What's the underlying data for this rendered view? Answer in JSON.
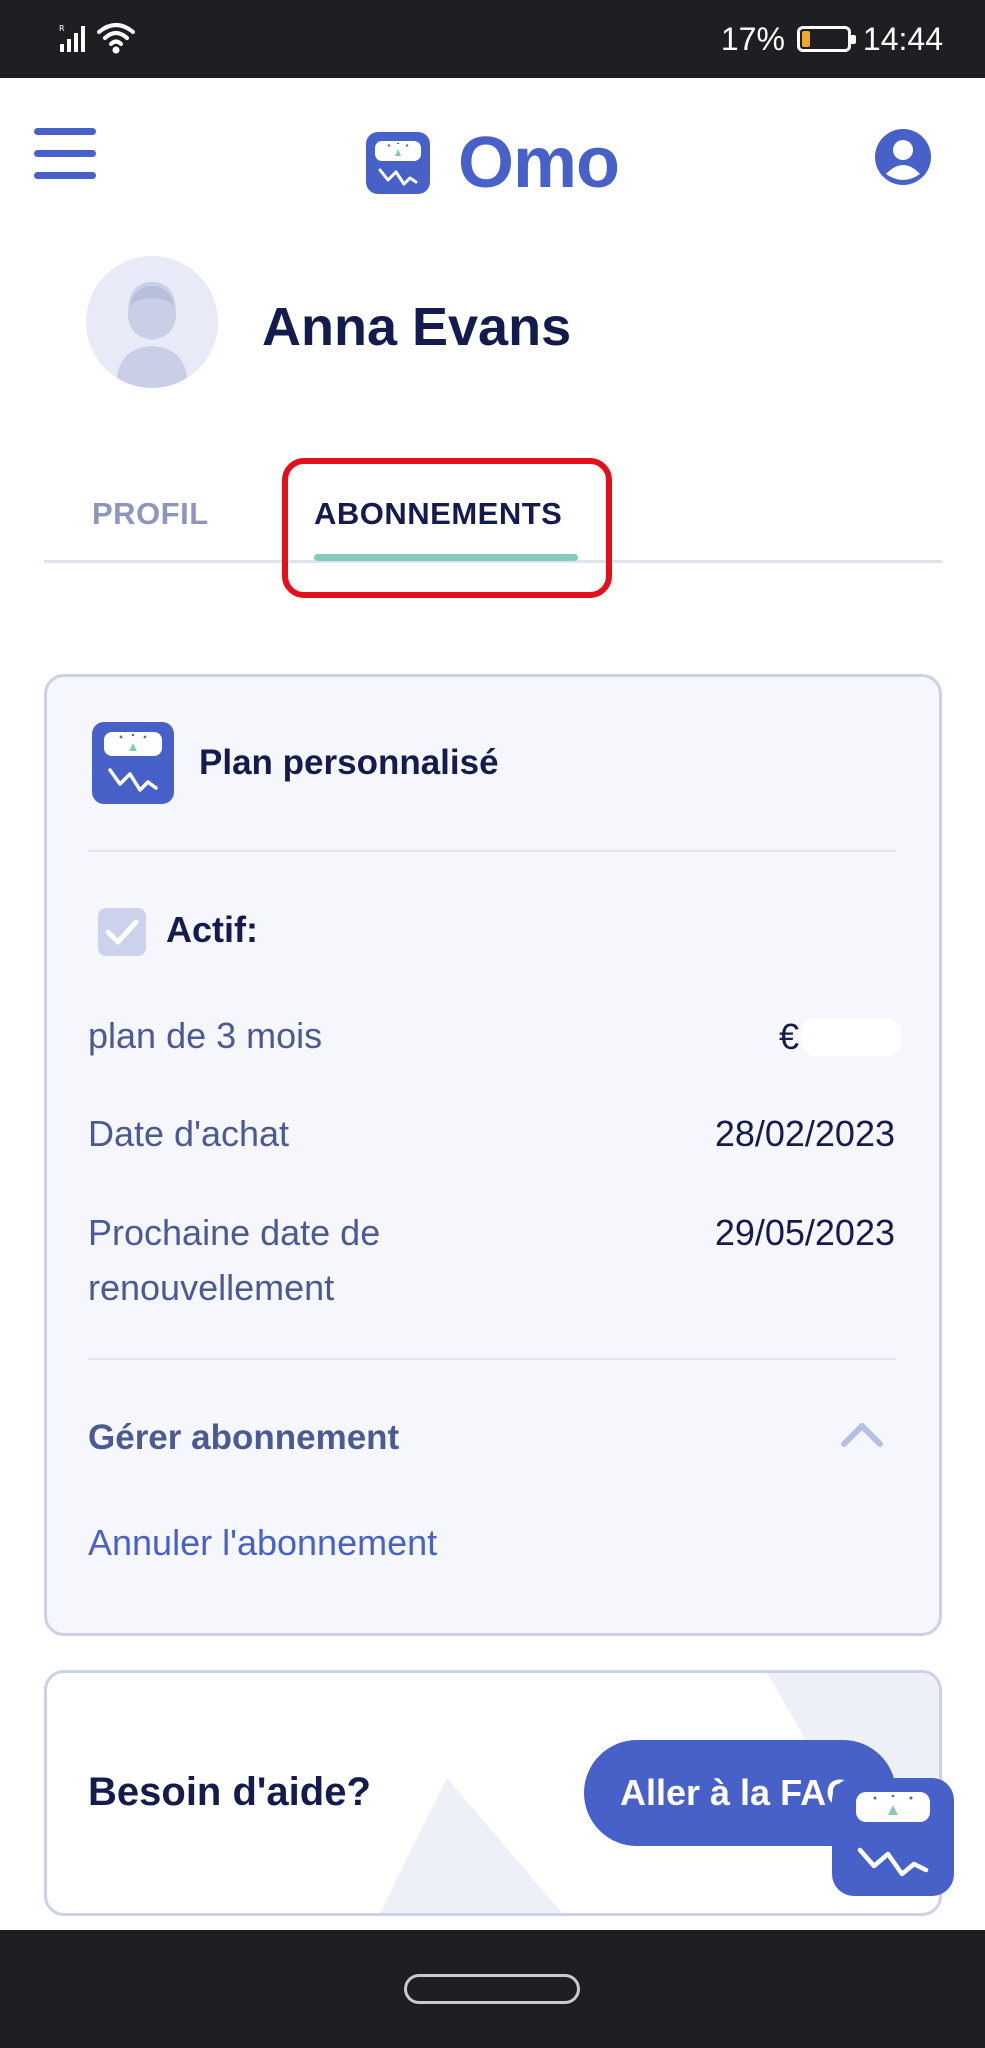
{
  "status_bar": {
    "battery": "17%",
    "battery_level": 0.17,
    "battery_color": "#f0a92d",
    "time": "14:44",
    "icons": [
      "signal-icon",
      "wifi-icon",
      "battery-icon"
    ]
  },
  "header": {
    "app_name": "Omo",
    "icons": [
      "menu-icon",
      "omo-logo-icon",
      "account-icon"
    ],
    "brand_color": "#4861c9"
  },
  "profile": {
    "name": "Anna Evans",
    "avatar_icon": "user-avatar-icon"
  },
  "tabs": [
    {
      "label": "PROFIL",
      "active": false
    },
    {
      "label": "ABONNEMENTS",
      "active": true
    }
  ],
  "subscription": {
    "plan_title": "Plan personnalisé",
    "status_label": "Actif:",
    "status_checked": true,
    "plan_label": "plan de 3 mois",
    "price_currency": "€",
    "purchase_date_label": "Date d'achat",
    "purchase_date": "28/02/2023",
    "renewal_label_line1": "Prochaine date de",
    "renewal_label_line2": "renouvellement",
    "renewal_date": "29/05/2023",
    "manage_title": "Gérer abonnement",
    "cancel_link": "Annuler l'abonnement"
  },
  "help": {
    "title": "Besoin d'aide?",
    "faq_button": "Aller à la FAQ"
  },
  "colors": {
    "accent": "#4861c9",
    "tab_underline": "#86c9c0",
    "highlight": "#e3101a",
    "text_dark": "#141c4d"
  }
}
